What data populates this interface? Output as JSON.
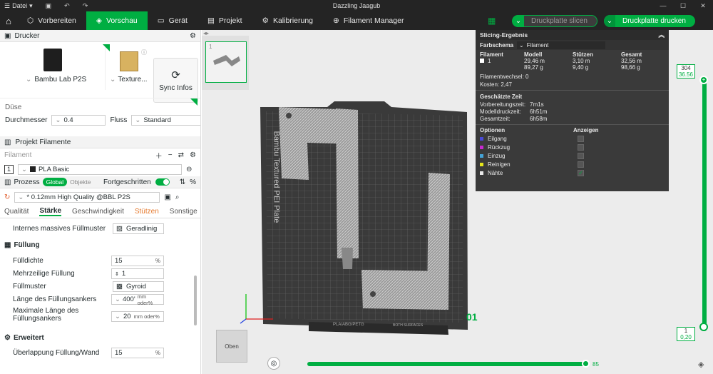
{
  "window": {
    "title": "Dazzling Jaagub",
    "file_menu": "Datei"
  },
  "toolbar": {
    "tabs": [
      {
        "label": "Vorbereiten"
      },
      {
        "label": "Vorschau"
      },
      {
        "label": "Gerät"
      },
      {
        "label": "Projekt"
      },
      {
        "label": "Kalibrierung"
      },
      {
        "label": "Filament Manager"
      }
    ],
    "slice_label": "Druckplatte slicen",
    "print_label": "Druckplatte drucken"
  },
  "printer": {
    "section_title": "Drucker",
    "printer_name": "Bambu Lab P2S",
    "plate_name": "Texture...",
    "sync_label": "Sync Infos",
    "nozzle_title": "Düse",
    "diameter_label": "Durchmesser",
    "diameter_value": "0.4",
    "flow_label": "Fluss",
    "flow_value": "Standard"
  },
  "filament": {
    "section_title": "Projekt Filamente",
    "placeholder": "Filament",
    "slot": "1",
    "name": "PLA Basic"
  },
  "process": {
    "title": "Prozess",
    "global": "Global",
    "objects": "Objekte",
    "advanced": "Fortgeschritten",
    "preset": "* 0.12mm High Quality @BBL P2S",
    "tabs": [
      "Qualität",
      "Stärke",
      "Geschwindigkeit",
      "Stützen",
      "Sonstige"
    ]
  },
  "settings": {
    "internal_pattern_label": "Internes massives Füllmuster",
    "internal_pattern_value": "Geradlinig",
    "infill_title": "Füllung",
    "density_label": "Fülldichte",
    "density_value": "15",
    "density_unit": "%",
    "multiline_label": "Mehrzeilige Füllung",
    "multiline_value": "1",
    "pattern_label": "Füllmuster",
    "pattern_value": "Gyroid",
    "anchor_label": "Länge des Füllungsankers",
    "anchor_value": "400'",
    "anchor_unit": "mm oder%",
    "maxanchor_label1": "Maximale Länge des",
    "maxanchor_label2": "Füllungsankers",
    "maxanchor_value": "20",
    "maxanchor_unit": "mm oder%",
    "advanced_title": "Erweitert",
    "overlap_label": "Überlappung Füllung/Wand",
    "overlap_value": "15",
    "overlap_unit": "%"
  },
  "viewport": {
    "thumb_number": "1",
    "plate_text": "Bambu Textured PEI Plate",
    "plate_number": "01",
    "bottom_label1": "PLA/ABG/PETG",
    "bottom_label2": "BOTH SURFACES",
    "view_cube": "Oben",
    "slider_top_layer": "304",
    "slider_top_height": "36.56",
    "slider_bottom_layer": "1",
    "slider_bottom_height": "0,20",
    "hslider_value": "85"
  },
  "slicing": {
    "title": "Slicing-Ergebnis",
    "color_scheme_label": "Farbschema",
    "color_scheme_value": "Filament",
    "headers": [
      "Filament",
      "Modell",
      "Stützen",
      "Gesamt"
    ],
    "row": {
      "id": "1",
      "model_m": "29,46 m",
      "model_g": "89,27 g",
      "support_m": "3,10 m",
      "support_g": "9,40 g",
      "total_m": "32,56 m",
      "total_g": "98,66 g"
    },
    "changes": "Filamentwechsel:  0",
    "cost": "Kosten:  2,47",
    "time_title": "Geschätzte Zeit",
    "prep_label": "Vorbereitungszeit:",
    "prep_value": "7m1s",
    "model_label": "Modelldruckzeit:",
    "model_value": "6h51m",
    "total_label": "Gesamtzeit:",
    "total_value": "6h58m",
    "options_title": "Optionen",
    "show_title": "Anzeigen",
    "options": [
      {
        "label": "Eilgang",
        "color": "#4a4ad8"
      },
      {
        "label": "Rückzug",
        "color": "#c72ad0"
      },
      {
        "label": "Einzug",
        "color": "#44a3d6"
      },
      {
        "label": "Reinigen",
        "color": "#e4e41c"
      },
      {
        "label": "Nähte",
        "color": "#e8e8e8"
      }
    ]
  },
  "colors": {
    "accent": "#00ae42",
    "dark": "#242424",
    "panel": "#3a3a3a"
  }
}
